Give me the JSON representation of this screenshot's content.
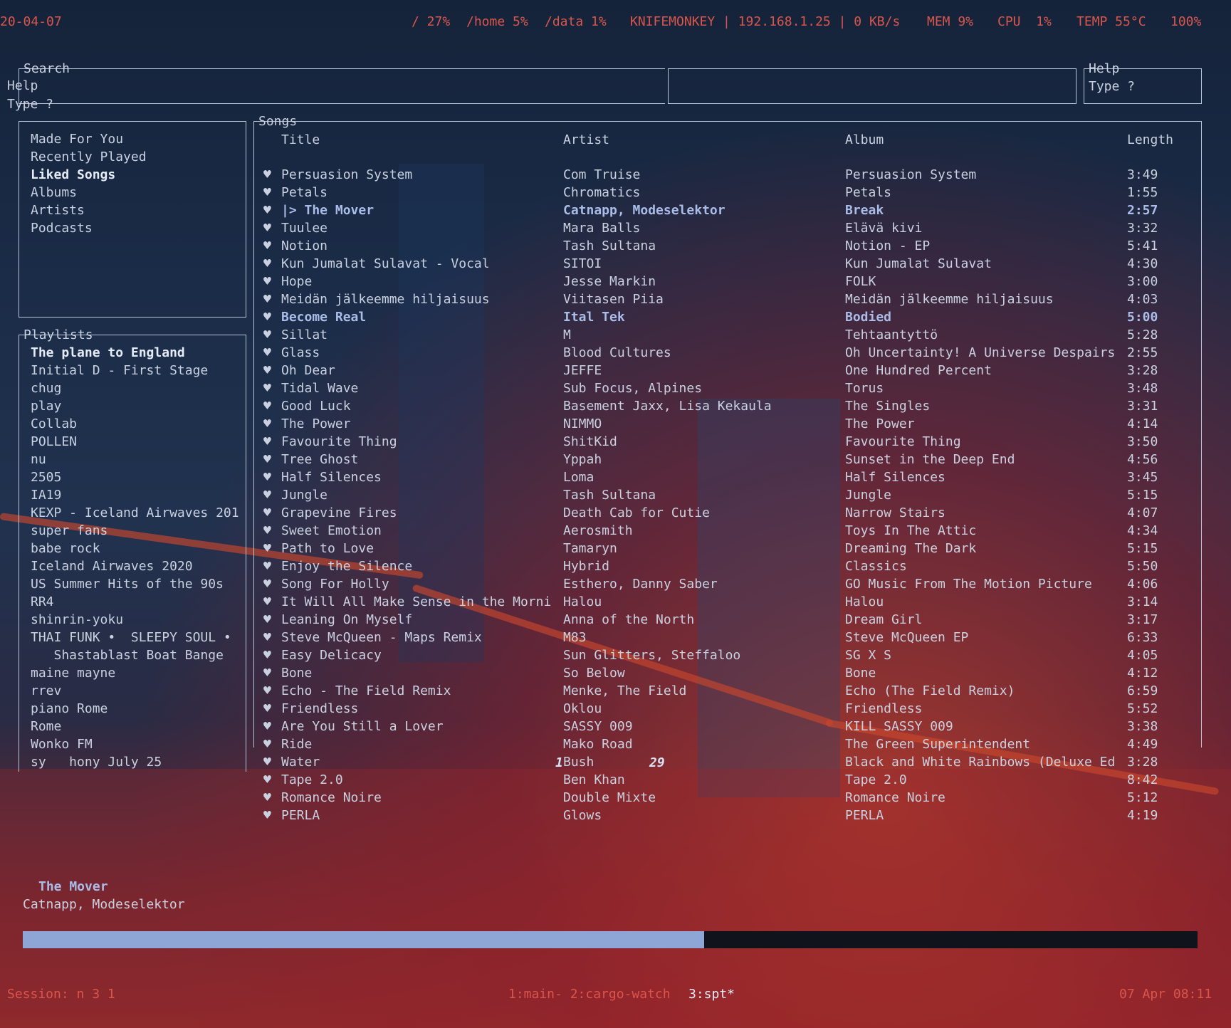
{
  "statusbar": {
    "date": "20-04-07",
    "root": "/ 27%",
    "home": "/home 5%",
    "data": "/data 1%",
    "net": "KNIFEMONKEY | 192.168.1.25 | 0 KB/s",
    "mem": "MEM 9%",
    "cpu": "CPU  1%",
    "temp": "TEMP 55°C",
    "battery": "100%"
  },
  "search": {
    "title": "Search",
    "help_title": "Help",
    "help_text": "Type ?"
  },
  "help": {
    "title": "Help",
    "text": "Type ?"
  },
  "library": {
    "items": [
      "Made For You",
      "Recently Played",
      "Liked Songs",
      "Albums",
      "Artists",
      "Podcasts"
    ],
    "selected": "Liked Songs"
  },
  "playlists": {
    "title": "Playlists",
    "items": [
      "The plane to England",
      "Initial D - First Stage",
      "chug",
      "play",
      "Collab",
      "POLLEN",
      "nu",
      "2505",
      "IA19",
      "KEXP - Iceland Airwaves 201",
      "super fans",
      "babe rock",
      "Iceland Airwaves 2020",
      "US Summer Hits of the 90s",
      "RR4",
      "shinrin-yoku",
      "THAI FUNK •  SLEEPY SOUL •",
      "   Shastablast Boat Bange",
      "maine mayne",
      "rrev",
      "piano Rome",
      "Rome",
      "Wonko FM",
      "sy   hony July 25"
    ]
  },
  "songs": {
    "title": "Songs",
    "headers": {
      "title": "Title",
      "artist": "Artist",
      "album": "Album",
      "length": "Length"
    },
    "heart": "♥",
    "rows": [
      {
        "title": "Persuasion System",
        "artist": "Com Truise",
        "album": "Persuasion System",
        "length": "3:49"
      },
      {
        "title": "Petals",
        "artist": "Chromatics",
        "album": "Petals",
        "length": "1:55"
      },
      {
        "title": "|> The Mover",
        "artist": "Catnapp, Modeselektor",
        "album": "Break",
        "length": "2:57",
        "state": "playing"
      },
      {
        "title": "Tuulee",
        "artist": "Mara Balls",
        "album": "Elävä kivi",
        "length": "3:32"
      },
      {
        "title": "Notion",
        "artist": "Tash Sultana",
        "album": "Notion - EP",
        "length": "5:41"
      },
      {
        "title": "Kun Jumalat Sulavat - Vocal",
        "artist": "SITOI",
        "album": "Kun Jumalat Sulavat",
        "length": "4:30"
      },
      {
        "title": "Hope",
        "artist": "Jesse Markin",
        "album": "FOLK",
        "length": "3:00"
      },
      {
        "title": "Meidän jälkeemme hiljaisuus",
        "artist": "Viitasen Piia",
        "album": "Meidän jälkeemme hiljaisuus",
        "length": "4:03"
      },
      {
        "title": "Become Real",
        "artist": "Ital Tek",
        "album": "Bodied",
        "length": "5:00",
        "state": "selected"
      },
      {
        "title": "Sillat",
        "artist": "M",
        "album": "Tehtaantyttö",
        "length": "5:28"
      },
      {
        "title": "Glass",
        "artist": "Blood Cultures",
        "album": "Oh Uncertainty! A Universe Despairs",
        "length": "2:55"
      },
      {
        "title": "Oh Dear",
        "artist": "JEFFE",
        "album": "One Hundred Percent",
        "length": "3:28"
      },
      {
        "title": "Tidal Wave",
        "artist": "Sub Focus, Alpines",
        "album": "Torus",
        "length": "3:48"
      },
      {
        "title": "Good Luck",
        "artist": "Basement Jaxx, Lisa Kekaula",
        "album": "The Singles",
        "length": "3:31"
      },
      {
        "title": "The Power",
        "artist": "NIMMO",
        "album": "The Power",
        "length": "4:14"
      },
      {
        "title": "Favourite Thing",
        "artist": "ShitKid",
        "album": "Favourite Thing",
        "length": "3:50"
      },
      {
        "title": "Tree Ghost",
        "artist": "Yppah",
        "album": "Sunset in the Deep End",
        "length": "4:56"
      },
      {
        "title": "Half Silences",
        "artist": "Loma",
        "album": "Half Silences",
        "length": "3:45"
      },
      {
        "title": "Jungle",
        "artist": "Tash Sultana",
        "album": "Jungle",
        "length": "5:15"
      },
      {
        "title": "Grapevine Fires",
        "artist": "Death Cab for Cutie",
        "album": "Narrow Stairs",
        "length": "4:07"
      },
      {
        "title": "Sweet Emotion",
        "artist": "Aerosmith",
        "album": "Toys In The Attic",
        "length": "4:34"
      },
      {
        "title": "Path to Love",
        "artist": "Tamaryn",
        "album": "Dreaming The Dark",
        "length": "5:15"
      },
      {
        "title": "Enjoy the Silence",
        "artist": "Hybrid",
        "album": "Classics",
        "length": "5:50"
      },
      {
        "title": "Song For Holly",
        "artist": "Esthero, Danny Saber",
        "album": "GO Music From The Motion Picture",
        "length": "4:06"
      },
      {
        "title": "It Will All Make Sense in the Morni",
        "artist": "Halou",
        "album": "Halou",
        "length": "3:14"
      },
      {
        "title": "Leaning On Myself",
        "artist": "Anna of the North",
        "album": "Dream Girl",
        "length": "3:17"
      },
      {
        "title": "Steve McQueen - Maps Remix",
        "artist": "M83",
        "album": "Steve McQueen EP",
        "length": "6:33"
      },
      {
        "title": "Easy Delicacy",
        "artist": "Sun Glitters, Steffaloo",
        "album": "SG X S",
        "length": "4:05"
      },
      {
        "title": "Bone",
        "artist": "So Below",
        "album": "Bone",
        "length": "4:12"
      },
      {
        "title": "Echo - The Field Remix",
        "artist": "Menke, The Field",
        "album": "Echo (The Field Remix)",
        "length": "6:59"
      },
      {
        "title": "Friendless",
        "artist": "Oklou",
        "album": "Friendless",
        "length": "5:52"
      },
      {
        "title": "Are You Still a Lover",
        "artist": "SASSY 009",
        "album": "KILL SASSY 009",
        "length": "3:38"
      },
      {
        "title": "Ride",
        "artist": "Mako Road",
        "album": "The Green Superintendent",
        "length": "4:49"
      },
      {
        "title": "Water",
        "artist": "Bush",
        "album": "Black and White Rainbows (Deluxe Ed",
        "length": "3:28"
      },
      {
        "title": "Tape 2.0",
        "artist": "Ben Khan",
        "album": "Tape 2.0",
        "length": "8:42"
      },
      {
        "title": "Romance Noire",
        "artist": "Double Mixte",
        "album": "Romance Noire",
        "length": "5:12"
      },
      {
        "title": "PERLA",
        "artist": "Glows",
        "album": "PERLA",
        "length": "4:19"
      }
    ]
  },
  "overlay": {
    "index": "1",
    "count": "29"
  },
  "now_playing": {
    "title": "The Mover",
    "artist": "Catnapp, Modeselektor",
    "progress_fraction": 0.58
  },
  "tmux": {
    "session": "Session: n 3 1",
    "windows": "1:main- 2:cargo-watch",
    "active_window": "3:spt*",
    "clock": "07 Apr 08:11"
  }
}
